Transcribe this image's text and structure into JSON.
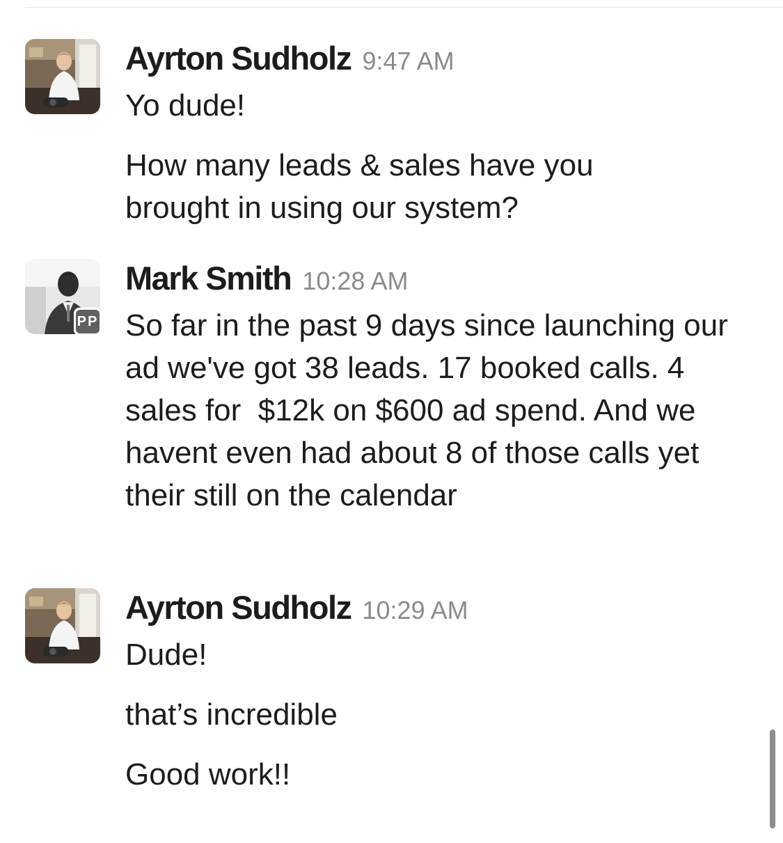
{
  "messages": [
    {
      "author": "Ayrton Sudholz",
      "time": "9:47 AM",
      "avatar_icon": "person-photo-icon",
      "paragraphs": [
        "Yo dude!",
        "How many leads & sales have you brought in using our system?"
      ]
    },
    {
      "author": "Mark Smith",
      "time": "10:28 AM",
      "avatar_icon": "person-photo-icon",
      "badge": "PP",
      "paragraphs": [
        "So far in the past 9 days since launching our ad we've got 38 leads. 17 booked calls. 4 sales for  $12k on $600 ad spend. And we havent even had about 8 of those calls yet their still on the calendar"
      ]
    },
    {
      "author": "Ayrton Sudholz",
      "time": "10:29 AM",
      "avatar_icon": "person-photo-icon",
      "paragraphs": [
        "Dude!",
        "that’s incredible",
        "Good work!!"
      ]
    }
  ],
  "colors": {
    "text": "#1d1c1d",
    "timestamp": "#8a8a8a",
    "badge_bg": "#616061",
    "scrollbar": "#8d8d8d"
  }
}
